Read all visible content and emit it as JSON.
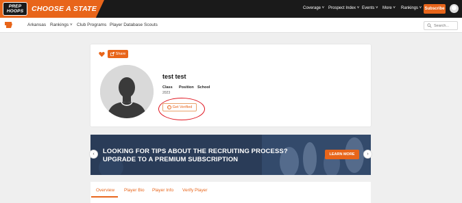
{
  "brand": {
    "logo_line1": "PREP",
    "logo_line2": "HOOPS",
    "title": "CHOOSE A STATE",
    "accent_color": "#e8651a",
    "nav_bg": "#1a1a1a"
  },
  "topnav": {
    "links": [
      "Coverage",
      "Prospect Index",
      "Events",
      "More",
      "Rankings"
    ],
    "subscribe_label": "Subscribe"
  },
  "subnav": {
    "links": [
      "Arkansas",
      "Rankings",
      "Club Programs",
      "Player Database",
      "Scouts"
    ],
    "search_placeholder": "Search..."
  },
  "profile": {
    "share_label": "Share",
    "name": "test test",
    "fields": [
      {
        "label": "Class",
        "value": "2023"
      },
      {
        "label": "Position",
        "value": ""
      },
      {
        "label": "School",
        "value": ""
      }
    ],
    "verify_label": "Get Verified",
    "highlight_color": "#e0121d"
  },
  "banner": {
    "line1": "LOOKING FOR TIPS ABOUT THE RECRUITING PROCESS?",
    "line2": "UPGRADE TO A PREMIUM SUBSCRIPTION",
    "cta_label": "LEARN MORE"
  },
  "tabs": [
    "Overview",
    "Player Bio",
    "Player Info",
    "Verify Player"
  ],
  "active_tab": "Overview"
}
